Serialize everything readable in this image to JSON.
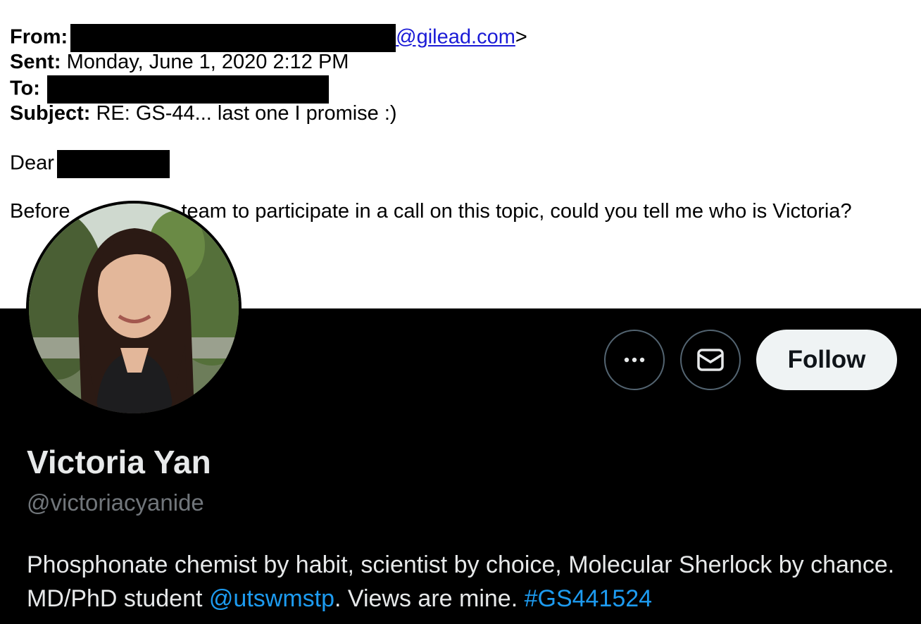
{
  "email": {
    "from_label": "From:",
    "from_domain": "@gilead.com",
    "from_suffix": ">",
    "sent_label": "Sent:",
    "sent_value": "Monday, June 1, 2020 2:12 PM",
    "to_label": "To:",
    "subject_label": "Subject:",
    "subject_value": "RE: GS-44... last one I promise :)",
    "greeting": "Dear",
    "body_start": "Before",
    "body_rest": "team to participate in a call on this topic, could you tell me who is Victoria?"
  },
  "profile": {
    "name": "Victoria Yan",
    "handle": "@victoriacyanide",
    "follow_label": "Follow",
    "more_icon": "more-icon",
    "message_icon": "envelope-icon",
    "bio": {
      "part1": "Phosphonate chemist by habit, scientist by choice, Molecular Sherlock by chance. MD/PhD student ",
      "mention": "@utswmstp",
      "part2": ". Views are mine. ",
      "hashtag": "#GS441524"
    }
  },
  "colors": {
    "background_dark": "#000000",
    "name_text": "#e7e9ea",
    "handle_text": "#71767b",
    "link": "#1d9bf0",
    "follow_button": "#eff3f4",
    "email_link": "#1a1ad6"
  }
}
